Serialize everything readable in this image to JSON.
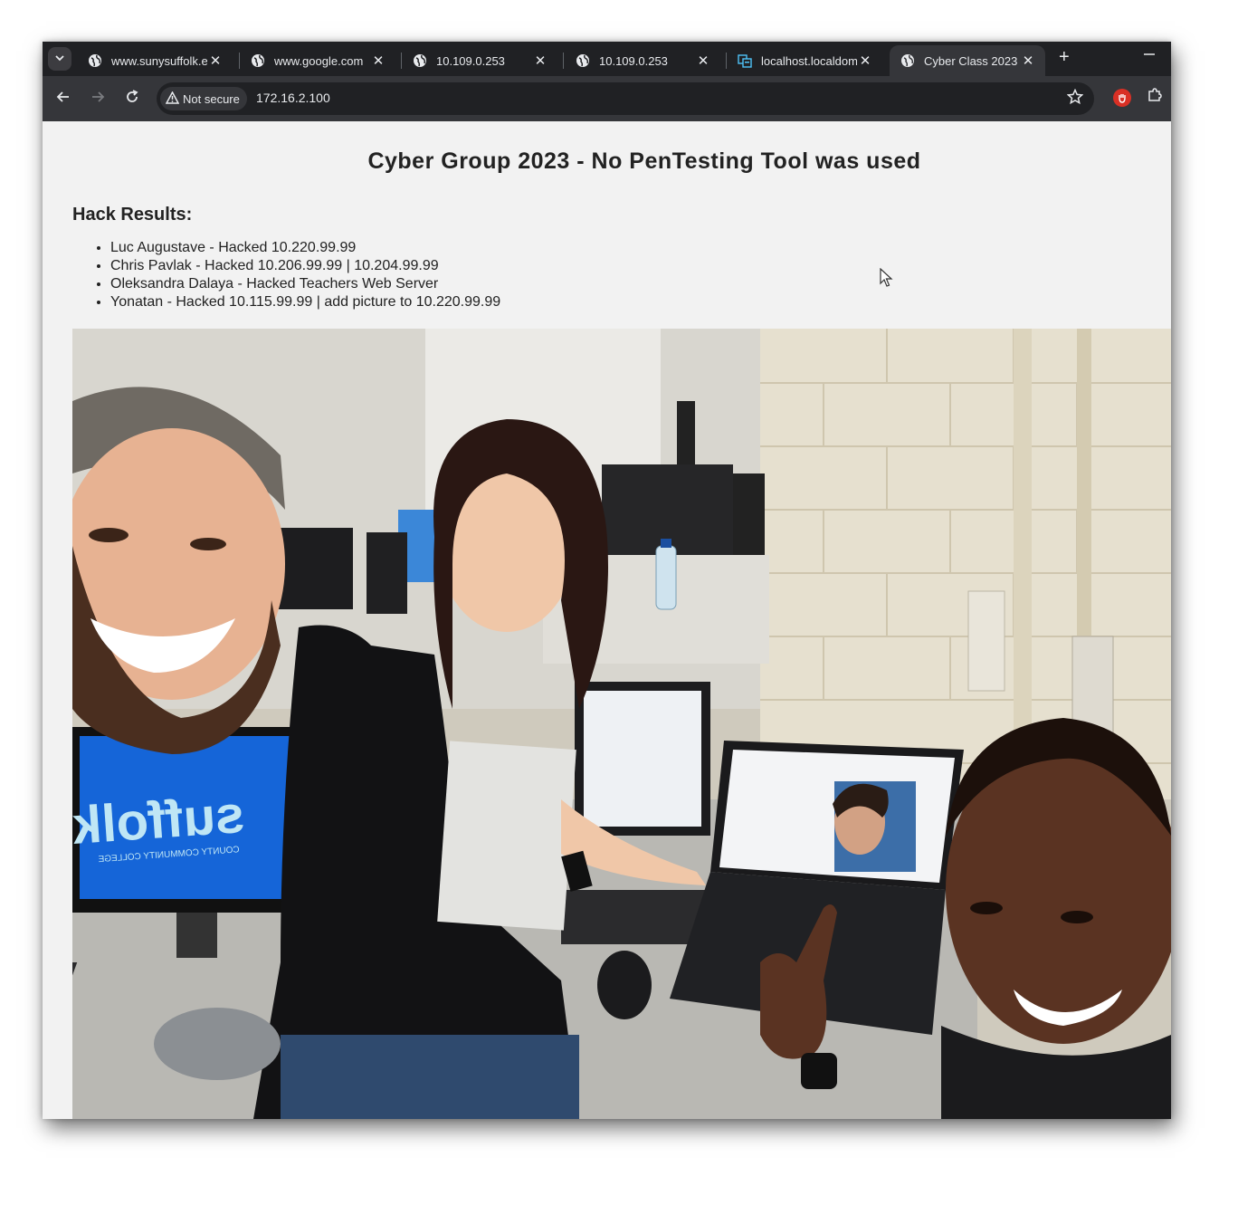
{
  "browser": {
    "tabs": [
      {
        "title": "www.sunysuffolk.e",
        "favicon": "globe-icon"
      },
      {
        "title": "www.google.com",
        "favicon": "globe-icon"
      },
      {
        "title": "10.109.0.253",
        "favicon": "globe-icon"
      },
      {
        "title": "10.109.0.253",
        "favicon": "globe-icon"
      },
      {
        "title": "localhost.localdom",
        "favicon": "server-icon"
      },
      {
        "title": "Cyber Class 2023",
        "favicon": "globe-icon",
        "active": true
      }
    ],
    "security_label": "Not secure",
    "url": "172.16.2.100",
    "new_tab_glyph": "+",
    "close_glyph": "✕"
  },
  "page": {
    "title": "Cyber Group 2023 - No PenTesting Tool was used",
    "results_heading": "Hack Results:",
    "results": [
      "Luc Augustave - Hacked 10.220.99.99",
      "Chris Pavlak - Hacked 10.206.99.99 | 10.204.99.99",
      "Oleksandra Dalaya - Hacked Teachers Web Server",
      "Yonatan - Hacked 10.115.99.99 | add picture to 10.220.99.99"
    ],
    "photo": {
      "monitor_text": "suffolk",
      "monitor_subtext": "COUNTY COMMUNITY COLLEGE"
    }
  },
  "colors": {
    "tabstrip": "#202124",
    "toolbar": "#35363a",
    "page_bg": "#f2f2f2",
    "monitor_blue": "#1565d8"
  }
}
